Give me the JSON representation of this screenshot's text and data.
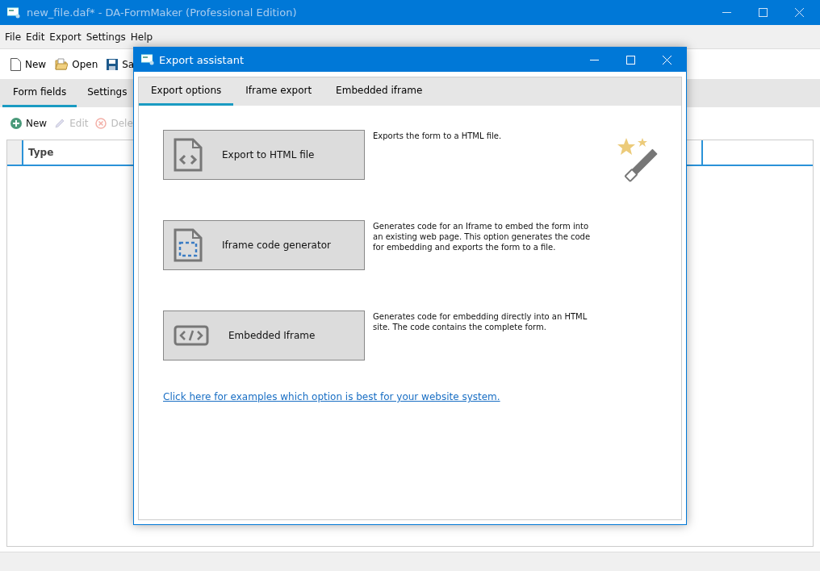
{
  "window": {
    "title": "new_file.daf* - DA-FormMaker (Professional Edition)"
  },
  "menu": [
    "File",
    "Edit",
    "Export",
    "Settings",
    "Help"
  ],
  "toolbar": [
    {
      "label": "New",
      "kind": "new"
    },
    {
      "label": "Open",
      "kind": "open"
    },
    {
      "label": "Sa",
      "kind": "save"
    }
  ],
  "tabs": [
    {
      "label": "Form fields",
      "selected": true
    },
    {
      "label": "Settings",
      "selected": false
    }
  ],
  "field_toolbar": [
    {
      "label": "New",
      "kind": "add",
      "disabled": false
    },
    {
      "label": "Edit",
      "kind": "edit",
      "disabled": true
    },
    {
      "label": "Dele",
      "kind": "delete",
      "disabled": true
    }
  ],
  "table": {
    "columns": [
      "Type"
    ]
  },
  "dialog": {
    "title": "Export assistant",
    "tabs": [
      {
        "label": "Export options",
        "selected": true
      },
      {
        "label": "Iframe export",
        "selected": false
      },
      {
        "label": "Embedded iframe",
        "selected": false
      }
    ],
    "options": [
      {
        "kind": "html",
        "label": "Export to HTML file",
        "description": "Exports the form to a HTML file."
      },
      {
        "kind": "iframe",
        "label": "Iframe code generator",
        "description": "Generates code for an Iframe to embed the form into an existing web page. This option generates the code for embedding and exports the form to a file."
      },
      {
        "kind": "embed",
        "label": "Embedded Iframe",
        "description": "Generates code for embedding directly into an HTML site. The code contains the complete form."
      }
    ],
    "link": "Click here for examples which option is best for your website system."
  }
}
